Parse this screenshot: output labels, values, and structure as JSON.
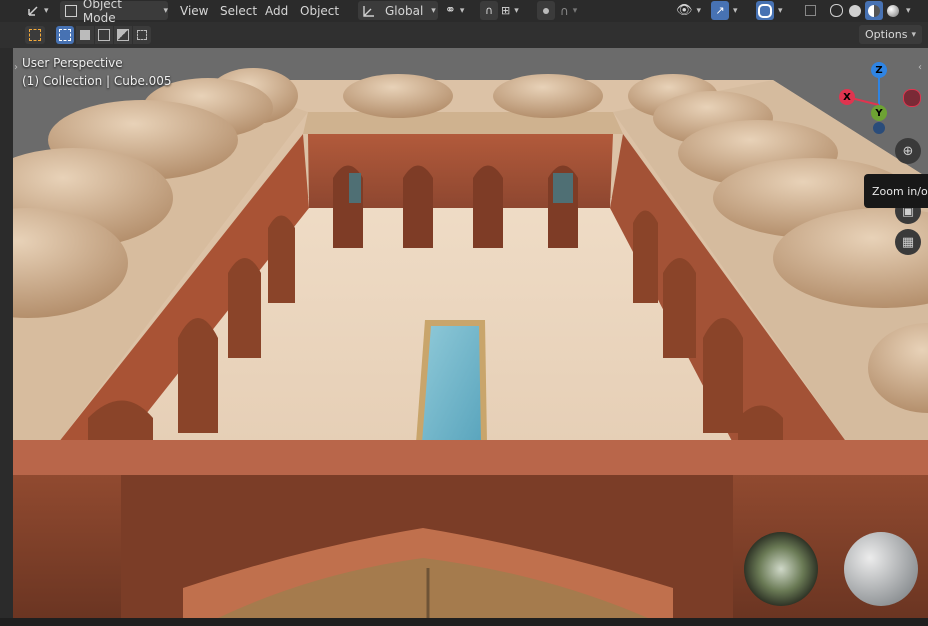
{
  "header": {
    "mode_label": "Object Mode",
    "menus": [
      "View",
      "Select",
      "Add",
      "Object"
    ],
    "transform_orientation": "Global"
  },
  "toolbar": {
    "options_label": "Options"
  },
  "viewport": {
    "perspective_label": "User Perspective",
    "collection_label": "(1) Collection | Cube.005",
    "gizmo": {
      "z": "Z",
      "x": "X",
      "y": "Y"
    },
    "tooltip": "Zoom in/out"
  },
  "colors": {
    "accent": "#4772b3",
    "axis_x": "#e0344f",
    "axis_y": "#6da233",
    "axis_z": "#2f84e3"
  }
}
